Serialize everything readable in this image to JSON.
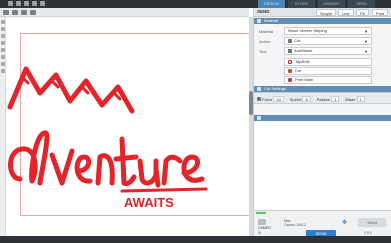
{
  "topbar": {
    "tabs": [
      {
        "label": "DESIGN",
        "active": true
      },
      {
        "label": "STORE",
        "active": false
      },
      {
        "label": "LIBRARY",
        "active": false
      },
      {
        "label": "SEND",
        "active": false
      }
    ]
  },
  "toolbar2": {
    "label": ""
  },
  "panel": {
    "header_title": "SEND",
    "buttons": {
      "simple": "Simple",
      "line": "Line",
      "fill": "Fill",
      "print": "Print"
    },
    "section1_title": "Material",
    "rows": {
      "material_label": "Material",
      "material_value": "Wood Veneer Striping",
      "action_label": "Action",
      "action_value": "Cut",
      "tool_label": "Tool",
      "tool_value": "AutoBlade"
    },
    "passes": [
      {
        "label": "Tap/Edit",
        "color": "#c0392b"
      },
      {
        "label": "Cut",
        "color": "#d14848"
      },
      {
        "label": "Print Mark",
        "color": "#c04040"
      }
    ],
    "blade": {
      "force": "33",
      "speed": "5",
      "passes": "1",
      "blade": "1"
    },
    "section2_title": "Cut Settings",
    "device_name": "CAMEO",
    "mat_line1": "Mat:",
    "mat_line2": "Cameo 12x12",
    "send_label": "Send",
    "bottom_main": "SEND",
    "bottom_left": "",
    "bottom_right": "0 5.0"
  },
  "colors": {
    "artwork_red": "#e4242b",
    "accent_blue": "#4a8fc8",
    "panel_bar": "#5f8db4"
  }
}
